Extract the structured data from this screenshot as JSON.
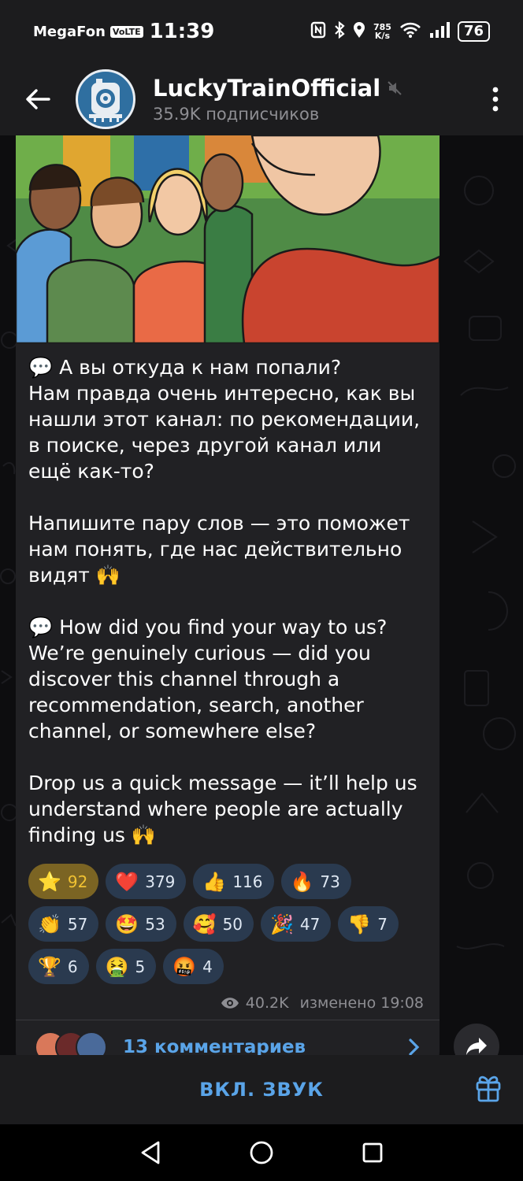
{
  "status": {
    "carrier": "MegaFon",
    "volte": "VoLTE",
    "time": "11:39",
    "speed_value": "785",
    "speed_unit": "K/s",
    "battery": "76"
  },
  "header": {
    "title": "LuckyTrainOfficial",
    "subscribers": "35.9K подписчиков"
  },
  "message": {
    "paragraphs": [
      "💬 А вы откуда к нам попали?\nНам правда очень интересно, как вы нашли этот канал: по рекомендации, в поиске, через другой канал или ещё как-то?",
      "Напишите пару слов — это поможет нам понять, где нас действительно видят 🙌",
      "💬 How did you find your way to us? We’re genuinely curious — did you discover this channel through a recommendation, search, another channel, or somewhere else?",
      "Drop us a quick message — it’ll help us understand where people are actually finding us 🙌"
    ],
    "reactions": [
      [
        {
          "emoji": "⭐",
          "count": "92",
          "active": true
        },
        {
          "emoji": "❤️",
          "count": "379"
        },
        {
          "emoji": "👍",
          "count": "116"
        },
        {
          "emoji": "🔥",
          "count": "73"
        }
      ],
      [
        {
          "emoji": "👏",
          "count": "57"
        },
        {
          "emoji": "🤩",
          "count": "53"
        },
        {
          "emoji": "🥰",
          "count": "50"
        },
        {
          "emoji": "🎉",
          "count": "47"
        },
        {
          "emoji": "👎",
          "count": "7"
        }
      ],
      [
        {
          "emoji": "🏆",
          "count": "6"
        },
        {
          "emoji": "🤮",
          "count": "5"
        },
        {
          "emoji": "🤬",
          "count": "4"
        }
      ]
    ],
    "views": "40.2K",
    "edited": "изменено 19:08",
    "comments_label": "13 комментариев"
  },
  "bottom": {
    "unmute_label": "ВКЛ. ЗВУК"
  },
  "colors": {
    "accent": "#5aa4e8",
    "bubble": "#212124",
    "header": "#1c1c1e",
    "reaction_bg": "#2a3a4f",
    "reaction_active_bg": "#7b6423"
  }
}
